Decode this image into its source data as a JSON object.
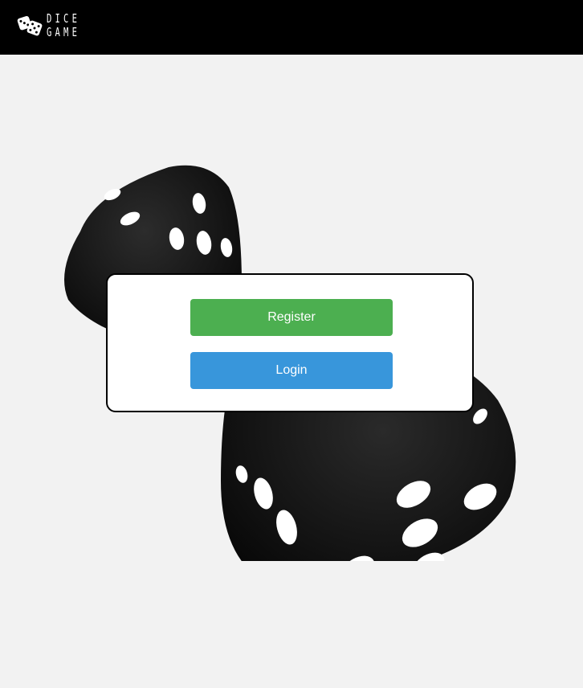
{
  "header": {
    "logo": {
      "icon": "dice-icon",
      "line1": "DICE",
      "line2": "GAME"
    }
  },
  "hero": {
    "image": "dice-illustration"
  },
  "auth_card": {
    "register_label": "Register",
    "login_label": "Login"
  },
  "colors": {
    "topbar": "#000000",
    "background": "#f2f2f2",
    "register_button": "#4caf50",
    "login_button": "#3896db"
  }
}
